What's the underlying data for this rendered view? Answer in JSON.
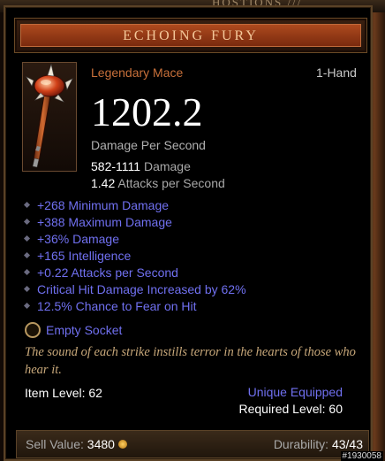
{
  "background": {
    "top_text": "HOSTIONS ///"
  },
  "item": {
    "name": "ECHOING FURY",
    "type": "Legendary Mace",
    "hand": "1-Hand",
    "dps": "1202.2",
    "dps_label": "Damage Per Second",
    "damage_range": "582-1111",
    "damage_label": "Damage",
    "attacks_per_second": "1.42",
    "attacks_label": "Attacks per Second",
    "affixes": [
      "+268 Minimum Damage",
      "+388 Maximum Damage",
      "+36% Damage",
      "+165 Intelligence",
      "+0.22 Attacks per Second",
      "Critical Hit Damage Increased by 62%",
      "12.5% Chance to Fear on Hit"
    ],
    "socket": "Empty Socket",
    "flavor_text": "The sound of each strike instills terror in the hearts of those who hear it.",
    "item_level": "Item Level: 62",
    "unique_equipped": "Unique Equipped",
    "required_level": "Required Level: 60",
    "sell_label": "Sell Value:",
    "sell_value": "3480",
    "durability_label": "Durability:",
    "durability_value": "43/43"
  },
  "watermark": "#1930058",
  "colors": {
    "legendary": "#c8703a",
    "magic_affix": "#7070f0",
    "flavor": "#c8a87a",
    "title_bar": "#ad4a1e"
  },
  "icons": {
    "item_icon": "mace-icon",
    "affix_bullet": "diamond-bullet-icon",
    "socket": "socket-ring-icon",
    "gold": "gold-coin-icon"
  }
}
